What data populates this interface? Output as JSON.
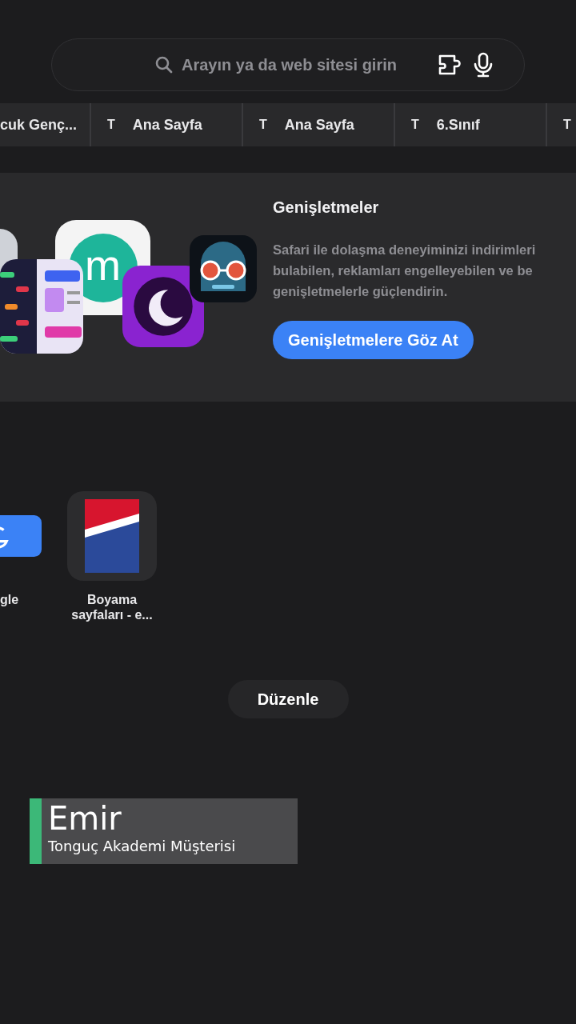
{
  "search": {
    "placeholder": "Arayın ya da web sitesi girin"
  },
  "tabs": [
    {
      "title": "cuk Genç..."
    },
    {
      "favicon": "T",
      "title": "Ana Sayfa"
    },
    {
      "favicon": "T",
      "title": "Ana Sayfa"
    },
    {
      "favicon": "T",
      "title": "6.Sınıf"
    },
    {
      "favicon": "T"
    }
  ],
  "extensions_card": {
    "icon_letter": "m",
    "title": "Genişletmeler",
    "description": [
      "Safari ile dolaşma deneyiminizi indirimleri",
      "bulabilen, reklamları engelleyebilen ve be",
      "genişletmelerle güçlendirin."
    ],
    "button": "Genişletmelere Göz At"
  },
  "favorites": [
    {
      "kind": "blue",
      "label": "gle"
    },
    {
      "kind": "flag",
      "label": "Boyama sayfaları - e..."
    }
  ],
  "edit_button": "Düzenle",
  "caption": {
    "name": "Emir",
    "subtitle": "Tonguç Akademi Müşterisi"
  }
}
